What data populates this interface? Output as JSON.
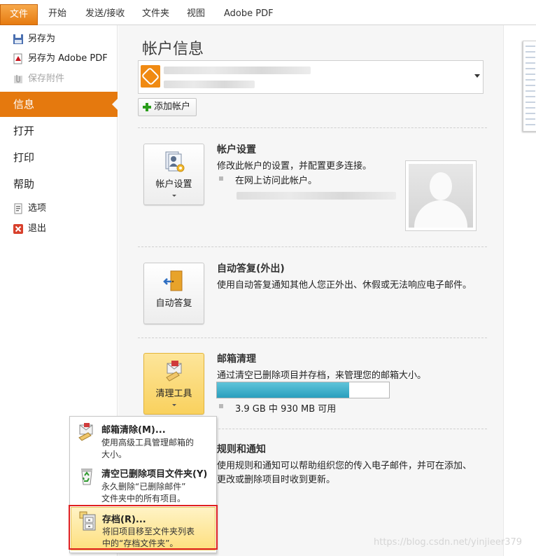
{
  "ribbon": {
    "file_tab": "文件",
    "tabs": [
      "开始",
      "发送/接收",
      "文件夹",
      "视图",
      "Adobe PDF"
    ]
  },
  "leftnav": {
    "save_as": "另存为",
    "save_as_pdf": "另存为 Adobe PDF",
    "save_attachments": "保存附件",
    "info": "信息",
    "open": "打开",
    "print": "打印",
    "help": "帮助",
    "options": "选项",
    "exit": "退出"
  },
  "main": {
    "title": "帐户信息",
    "add_account": "添加帐户",
    "account_settings": {
      "button": "帐户设置",
      "title": "帐户设置",
      "desc": "修改此帐户的设置，并配置更多连接。",
      "bullet": "在网上访问此帐户。"
    },
    "auto_reply": {
      "button": "自动答复",
      "title": "自动答复(外出)",
      "desc": "使用自动答复通知其他人您正外出、休假或无法响应电子邮件。"
    },
    "cleanup": {
      "button": "清理工具",
      "title": "邮箱清理",
      "desc": "通过清空已删除项目并存档，来管理您的邮箱大小。",
      "usage_text": "3.9 GB 中 930 MB 可用",
      "usage_fraction": 0.77
    },
    "rules": {
      "title": "规则和通知",
      "desc_line1": "使用规则和通知可以帮助组织您的传入电子邮件，并可在添加、",
      "desc_line2": "更改或删除项目时收到更新。"
    }
  },
  "menu": {
    "items": [
      {
        "title": "邮箱清除(M)...",
        "desc1": "使用高级工具管理邮箱的",
        "desc2": "大小。"
      },
      {
        "title": "清空已删除项目文件夹(Y)",
        "desc1": "永久删除“已删除邮件”",
        "desc2": "文件夹中的所有项目。"
      },
      {
        "title": "存档(R)...",
        "desc1": "将旧项目移至文件夹列表",
        "desc2": "中的“存档文件夹”。"
      }
    ]
  },
  "watermark": "https://blog.csdn.net/yinjieer379",
  "colors": {
    "accent_orange": "#e5790e",
    "progress_blue": "#2a9fbd",
    "highlight_red": "#e02020"
  }
}
